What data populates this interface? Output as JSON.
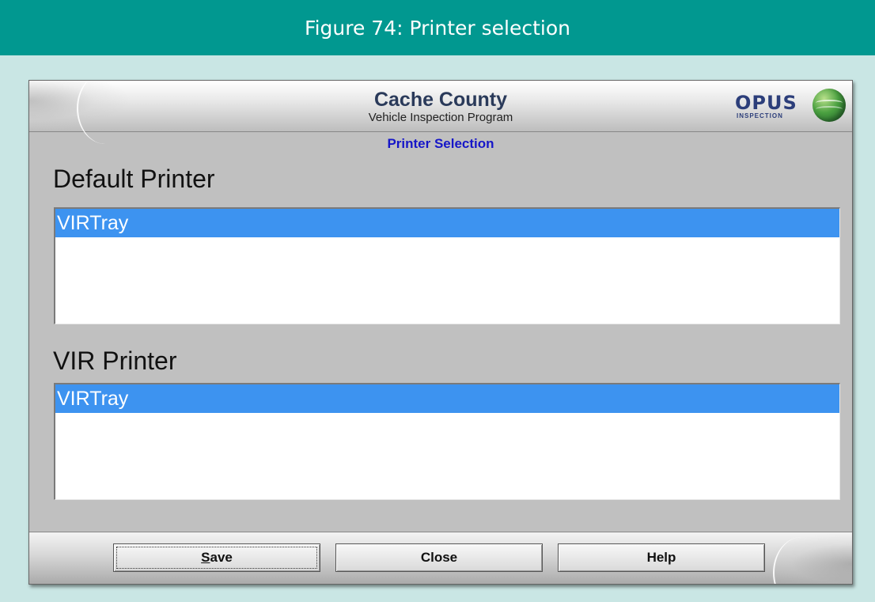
{
  "figure": {
    "caption": "Figure 74: Printer selection"
  },
  "header": {
    "title": "Cache County",
    "subtitle": "Vehicle Inspection Program",
    "logo_text": "OPUS",
    "logo_subtext": "INSPECTION"
  },
  "screen": {
    "title": "Printer Selection"
  },
  "default_printer": {
    "label": "Default Printer",
    "items": [
      "VIRTray"
    ],
    "selected": "VIRTray"
  },
  "vir_printer": {
    "label": "VIR Printer",
    "items": [
      "VIRTray"
    ],
    "selected": "VIRTray"
  },
  "buttons": {
    "save": {
      "mnemonic": "S",
      "rest": "ave"
    },
    "close": "Close",
    "help": "Help"
  },
  "colors": {
    "figure_bar": "#019890",
    "page_background": "#c9e6e4",
    "selection": "#3d93f0",
    "screen_title": "#1616c8"
  }
}
